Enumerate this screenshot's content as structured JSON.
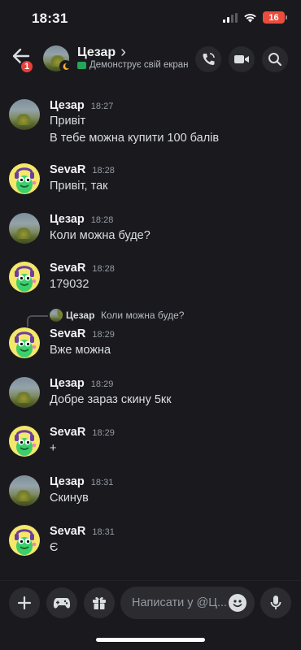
{
  "status_bar": {
    "time": "18:31",
    "battery": "16"
  },
  "header": {
    "back_badge": "1",
    "name": "Цезар",
    "chevron": "›",
    "subtitle": "Демонструє свій екран"
  },
  "messages": [
    {
      "author": "Цезар",
      "time": "18:27",
      "lines": [
        "Привіт",
        "В тебе можна купити 100 балів"
      ],
      "avatar": "cezar"
    },
    {
      "author": "SevaR",
      "time": "18:28",
      "lines": [
        "Привіт, так"
      ],
      "avatar": "seva"
    },
    {
      "author": "Цезар",
      "time": "18:28",
      "lines": [
        "Коли можна буде?"
      ],
      "avatar": "cezar"
    },
    {
      "author": "SevaR",
      "time": "18:28",
      "lines": [
        "179032"
      ],
      "avatar": "seva"
    },
    {
      "author": "SevaR",
      "time": "18:29",
      "lines": [
        "Вже можна"
      ],
      "avatar": "seva"
    },
    {
      "author": "Цезар",
      "time": "18:29",
      "lines": [
        "Добре зараз скину 5кк"
      ],
      "avatar": "cezar"
    },
    {
      "author": "SevaR",
      "time": "18:29",
      "lines": [
        "+"
      ],
      "avatar": "seva"
    },
    {
      "author": "Цезар",
      "time": "18:31",
      "lines": [
        "Скинув"
      ],
      "avatar": "cezar"
    },
    {
      "author": "SevaR",
      "time": "18:31",
      "lines": [
        "Є"
      ],
      "avatar": "seva"
    }
  ],
  "reply": {
    "author": "Цезар",
    "text": "Коли можна буде?"
  },
  "composer": {
    "placeholder": "Написати у @Ц..."
  },
  "colors": {
    "background": "#1a1a1e",
    "online": "#23a55a",
    "badge": "#e7403c",
    "battery": "#eb4d3d"
  }
}
